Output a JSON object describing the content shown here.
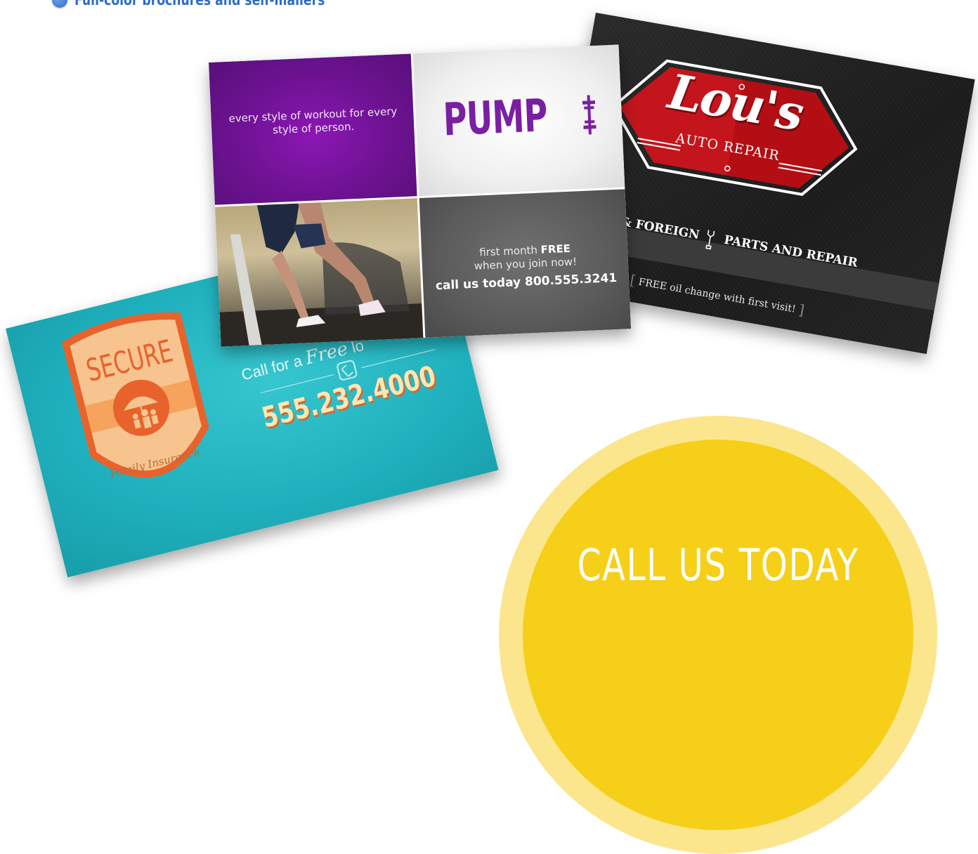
{
  "header": {
    "bullet_text": "Full-color brochures and self-mailers"
  },
  "cards": {
    "lous": {
      "title": "Lou's",
      "subtitle": "AUTO REPAIR",
      "band_left": "OMESTIC & FOREIGN",
      "band_right": "PARTS AND REPAIR",
      "offer": "FREE oil change with first visit!",
      "bracket_open": "[",
      "bracket_close": "]",
      "colors": {
        "badge": "#c4151c",
        "background": "#1e1e1e"
      }
    },
    "pump": {
      "tagline": "every style of workout for every style of person.",
      "logo": "PUMP",
      "offer_prefix": "first month",
      "offer_free": "FREE",
      "offer_line2": "when you join now!",
      "cta": "call us today 800.555.3241",
      "colors": {
        "purple": "#7b1fa2",
        "gray": "#5b5b5b"
      }
    },
    "secure": {
      "title": "SECURE",
      "tagline": "Family Insurance",
      "call_prefix": "Call for a",
      "call_italic": "Free",
      "call_suffix": "lo",
      "phone": "555.232.4000",
      "colors": {
        "background": "#1fb0bd",
        "accent": "#e8622c"
      }
    }
  },
  "call_badge": {
    "text": "CALL US TODAY",
    "colors": {
      "outer": "#fbe68e",
      "inner": "#f6cf18"
    }
  },
  "icons": [
    "bullet-dot-icon",
    "wrench-icon",
    "dumbbell-icon",
    "phone-icon",
    "family-umbrella-icon",
    "shield-icon"
  ]
}
